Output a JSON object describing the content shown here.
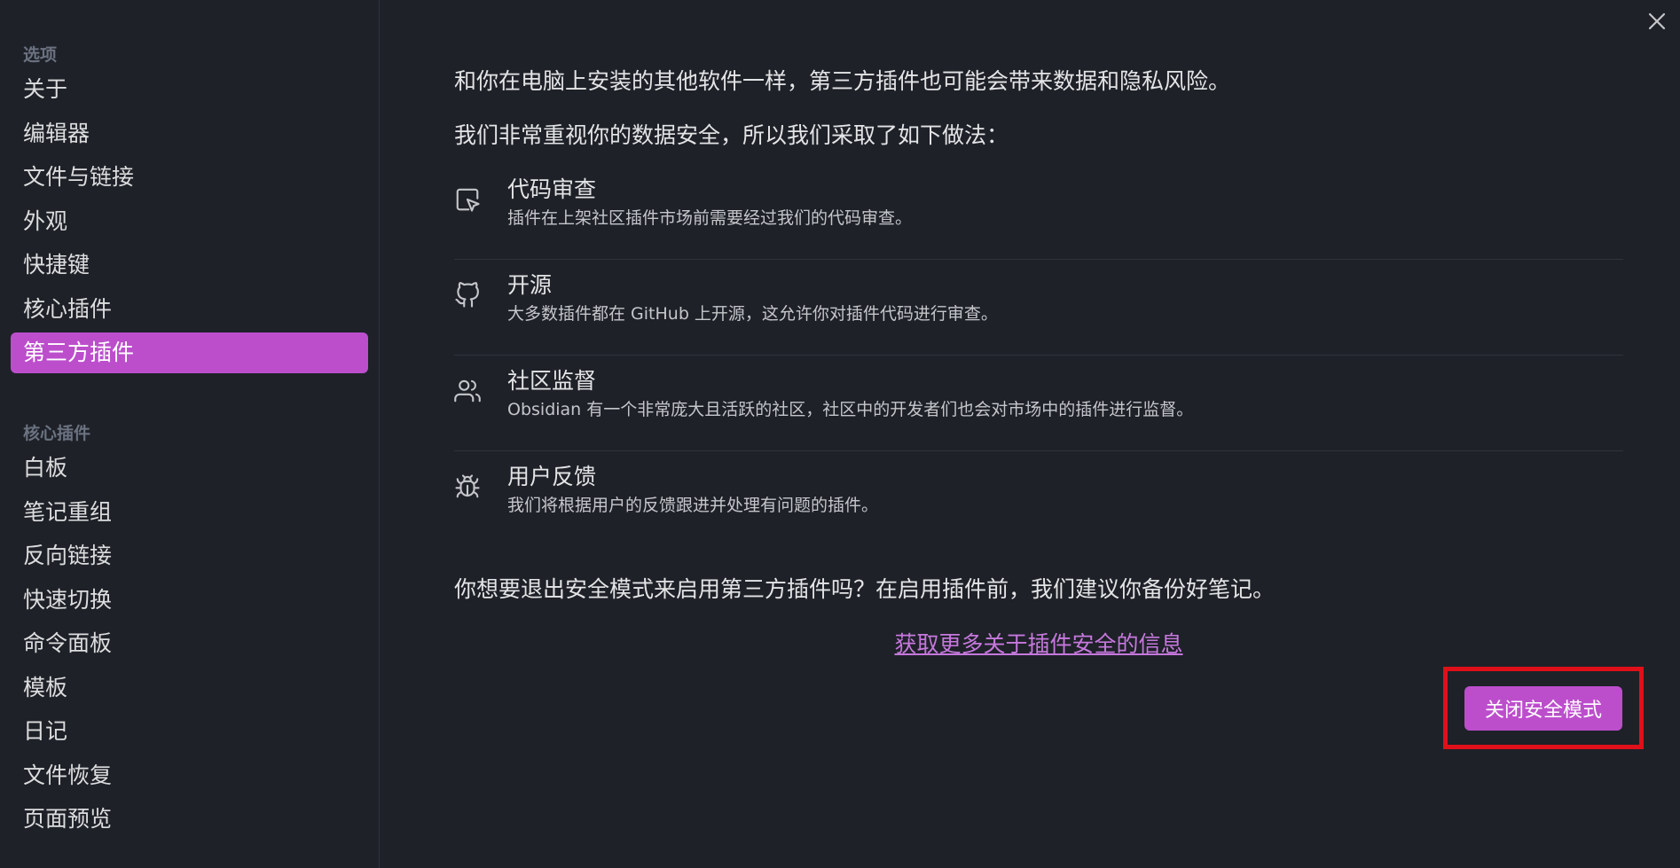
{
  "sidebar": {
    "options_title": "选项",
    "options_items": [
      {
        "label": "关于"
      },
      {
        "label": "编辑器"
      },
      {
        "label": "文件与链接"
      },
      {
        "label": "外观"
      },
      {
        "label": "快捷键"
      },
      {
        "label": "核心插件"
      },
      {
        "label": "第三方插件",
        "active": true
      }
    ],
    "core_title": "核心插件",
    "core_items": [
      {
        "label": "白板"
      },
      {
        "label": "笔记重组"
      },
      {
        "label": "反向链接"
      },
      {
        "label": "快速切换"
      },
      {
        "label": "命令面板"
      },
      {
        "label": "模板"
      },
      {
        "label": "日记"
      },
      {
        "label": "文件恢复"
      },
      {
        "label": "页面预览"
      }
    ]
  },
  "main": {
    "close_icon": "close-icon",
    "intro_1": "和你在电脑上安装的其他软件一样，第三方插件也可能会带来数据和隐私风险。",
    "intro_2": "我们非常重视你的数据安全，所以我们采取了如下做法：",
    "features": [
      {
        "icon": "code-review-icon",
        "title": "代码审查",
        "desc": "插件在上架社区插件市场前需要经过我们的代码审查。"
      },
      {
        "icon": "github-icon",
        "title": "开源",
        "desc": "大多数插件都在 GitHub 上开源，这允许你对插件代码进行审查。"
      },
      {
        "icon": "users-icon",
        "title": "社区监督",
        "desc": "Obsidian 有一个非常庞大且活跃的社区，社区中的开发者们也会对市场中的插件进行监督。"
      },
      {
        "icon": "bug-icon",
        "title": "用户反馈",
        "desc": "我们将根据用户的反馈跟进并处理有问题的插件。"
      }
    ],
    "question": "你想要退出安全模式来启用第三方插件吗？在启用插件前，我们建议你备份好笔记。",
    "learn_more": "获取更多关于插件安全的信息",
    "turn_off_safe_mode": "关闭安全模式"
  },
  "colors": {
    "accent": "#bc4ecc",
    "link": "#c678dd",
    "highlight_border": "#e0101a",
    "background": "#1e2128"
  }
}
